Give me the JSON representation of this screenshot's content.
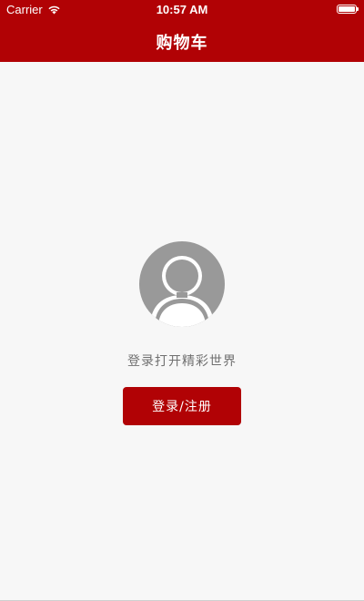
{
  "status_bar": {
    "carrier": "Carrier",
    "time": "10:57 AM",
    "battery_level": 1.0,
    "wifi_icon": "wifi-icon",
    "battery_icon": "battery-icon"
  },
  "nav": {
    "title": "购物车"
  },
  "empty_state": {
    "avatar_icon": "user-avatar-icon",
    "hint": "登录打开精彩世界",
    "login_button_label": "登录/注册"
  },
  "colors": {
    "brand_red": "#b10205",
    "background": "#f7f7f7",
    "hint_text": "#707070",
    "avatar_gray": "#999999"
  }
}
